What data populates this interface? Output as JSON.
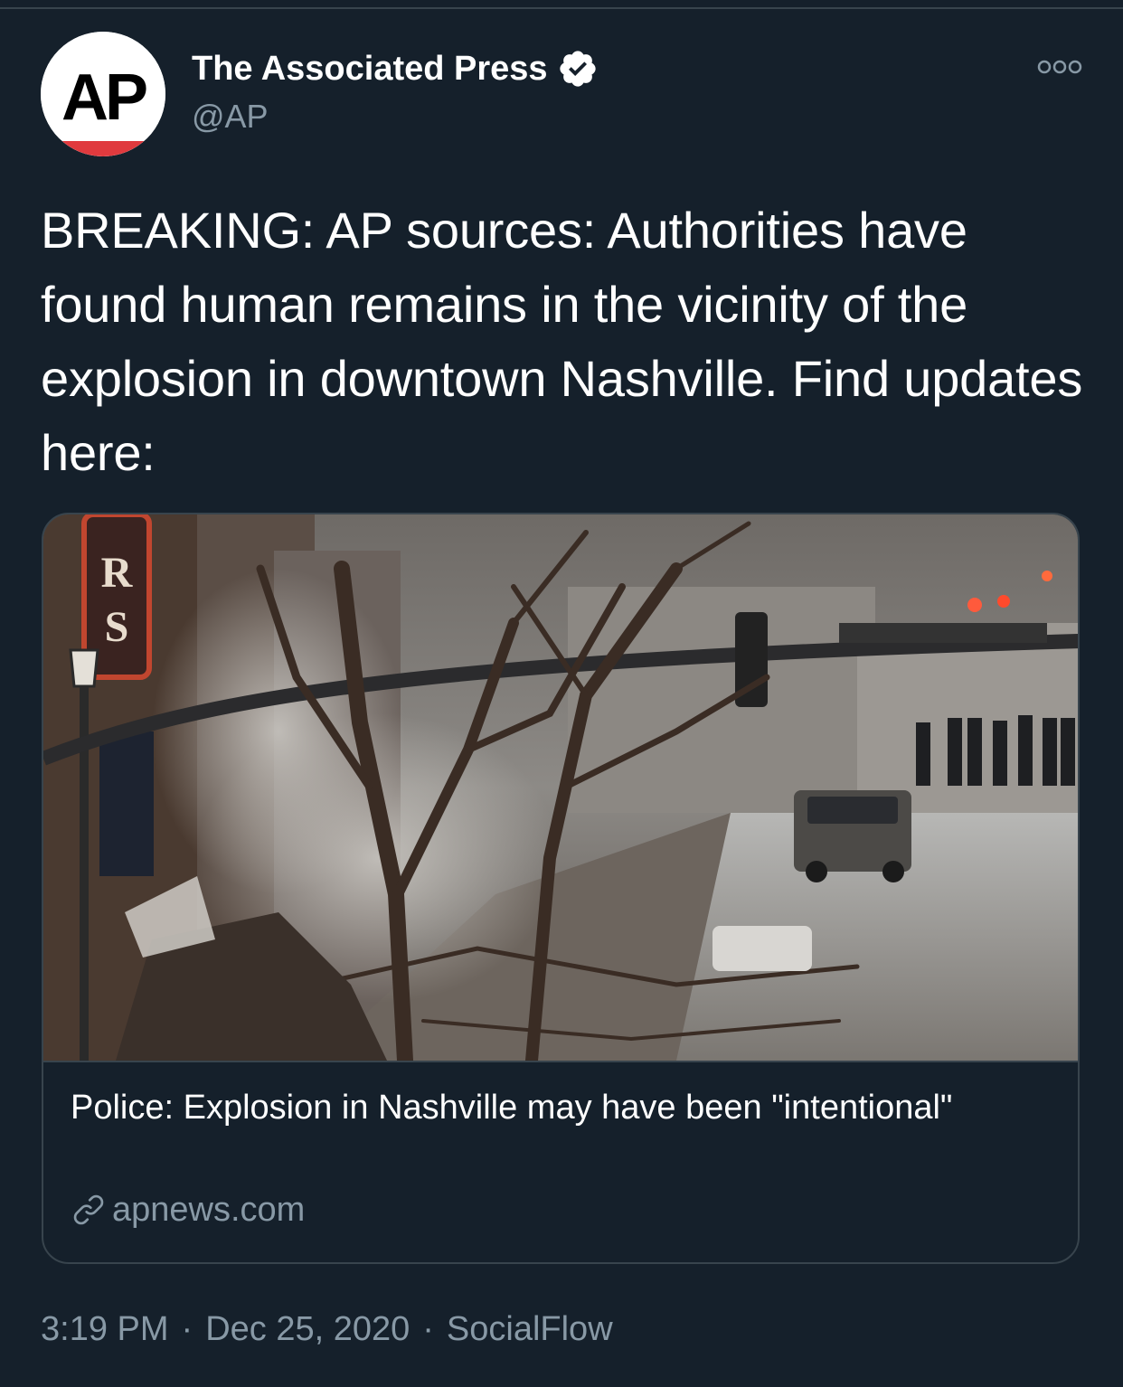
{
  "tweet": {
    "author": {
      "display_name": "The Associated Press",
      "handle": "@AP",
      "verified": true,
      "avatar_text": "AP"
    },
    "text": "BREAKING: AP sources: Authorities have found human remains in the vicinity of the explosion in downtown Nashville. Find updates here:",
    "card": {
      "title": "Police: Explosion in Nashville may have been \"intentional\"",
      "domain": "apnews.com"
    },
    "time": "3:19 PM",
    "date": "Dec 25, 2020",
    "source": "SocialFlow",
    "separator": "·"
  },
  "icons": {
    "verified": "verified-badge-icon",
    "more": "more-options-icon",
    "link": "link-icon"
  },
  "colors": {
    "background": "#15202b",
    "border": "#38444d",
    "secondary_text": "#8899a6",
    "primary_text": "#ffffff",
    "ap_red": "#e03a3e"
  }
}
